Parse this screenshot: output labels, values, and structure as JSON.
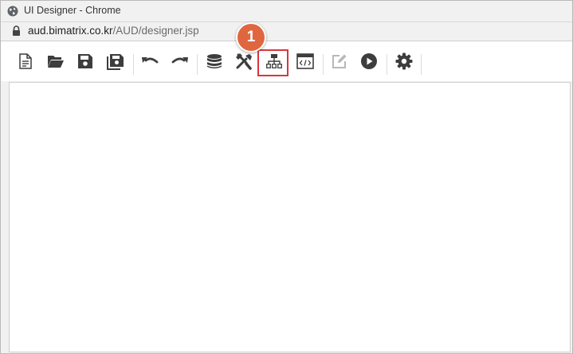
{
  "window": {
    "title": "UI Designer - Chrome"
  },
  "address": {
    "domain": "aud.bimatrix.co.kr",
    "path": "/AUD/designer.jsp"
  },
  "toolbar": {
    "buttons": [
      {
        "icon": "new-file-icon"
      },
      {
        "icon": "open-folder-icon"
      },
      {
        "icon": "save-icon"
      },
      {
        "icon": "save-all-icon"
      },
      {
        "icon": "undo-icon"
      },
      {
        "icon": "redo-icon"
      },
      {
        "icon": "database-icon"
      },
      {
        "icon": "tools-icon"
      },
      {
        "icon": "hierarchy-icon"
      },
      {
        "icon": "script-editor-icon"
      },
      {
        "icon": "edit-icon",
        "disabled": true
      },
      {
        "icon": "play-icon"
      },
      {
        "icon": "settings-icon"
      }
    ]
  },
  "annotation": {
    "step": "1",
    "color": "#e0663f",
    "box_color": "#d9363e"
  }
}
